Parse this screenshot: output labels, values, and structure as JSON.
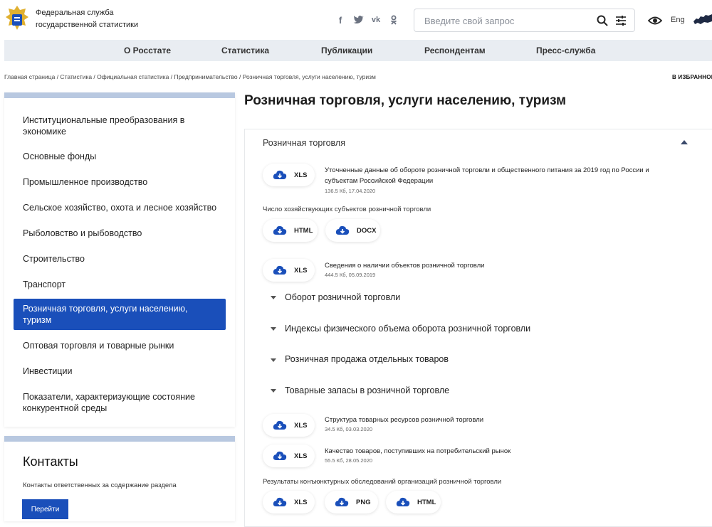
{
  "header": {
    "org_name_line1": "Федеральная служба",
    "org_name_line2": "государственной статистики",
    "search_placeholder": "Введите свой запрос",
    "lang": "Eng"
  },
  "nav": [
    "О Росстате",
    "Статистика",
    "Публикации",
    "Респондентам",
    "Пресс-служба"
  ],
  "breadcrumb": "Главная страница / Статистика / Официальная статистика / Предпринимательство / Розничная торговля, услуги населению, туризм",
  "favorites": "В ИЗБРАННОЕ",
  "sidebar": {
    "items": [
      "Институциональные преобразования в экономике",
      "Основные фонды",
      "Промышленное производство",
      "Сельское хозяйство, охота и лесное хозяйство",
      "Рыболовство и рыбоводство",
      "Строительство",
      "Транспорт",
      "Розничная торговля, услуги населению, туризм",
      "Оптовая торговля и товарные рынки",
      "Инвестиции",
      "Показатели, характеризующие состояние конкурентной среды"
    ]
  },
  "contacts": {
    "title": "Контакты",
    "text": "Контакты ответственных за содержание раздела",
    "button": "Перейти"
  },
  "main": {
    "title": "Розничная торговля, услуги населению, туризм",
    "section_title": "Розничная торговля",
    "file1": {
      "btn": "XLS",
      "title": "Уточненные данные об обороте розничной торговли и общественного питания за 2019 год по России и субъектам Российской Федерации",
      "meta": "136.5 Кб, 17.04.2020"
    },
    "label1": "Число хозяйствующих субъектов розничной торговли",
    "label1_btns": [
      "HTML",
      "DOCX"
    ],
    "file2": {
      "btn": "XLS",
      "title": "Сведения о наличии объектов розничной торговли",
      "meta": "444.5 Кб, 05.09.2019"
    },
    "collapsed": [
      "Оборот розничной торговли",
      "Индексы физического объема оборота розничной торговли",
      "Розничная продажа отдельных товаров",
      "Товарные запасы в розничной торговле"
    ],
    "file3": {
      "btn": "XLS",
      "title": "Структура товарных ресурсов розничной торговли",
      "meta": "34.5 Кб, 03.03.2020"
    },
    "file4": {
      "btn": "XLS",
      "title": "Качество товаров, поступивших на потребительский рынок",
      "meta": "55.5 Кб, 28.05.2020"
    },
    "label2": "Результаты конъюнктурных обследований организаций розничной торговли",
    "label2_btns": [
      "XLS",
      "PNG",
      "HTML"
    ]
  }
}
